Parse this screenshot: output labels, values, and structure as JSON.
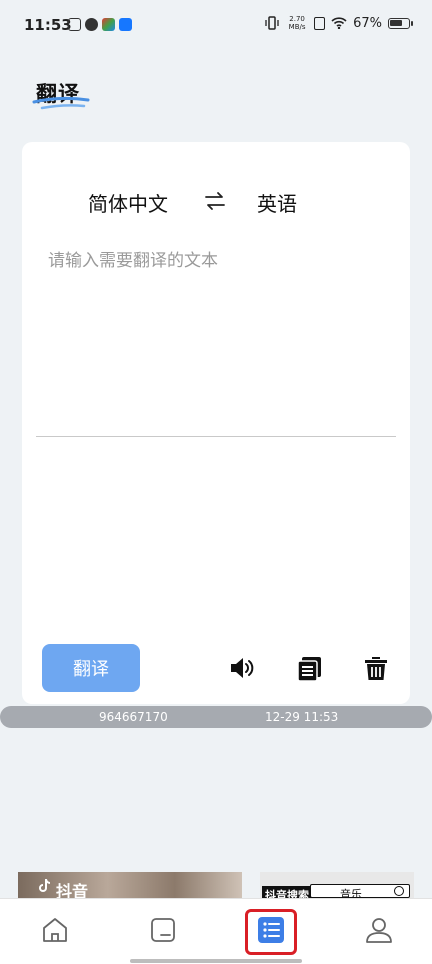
{
  "status_bar": {
    "time": "11:53",
    "net_speed_value": "2.70",
    "net_speed_unit": "MB/s",
    "battery_percent": "67%"
  },
  "header": {
    "title": "翻译"
  },
  "translator": {
    "source_language": "简体中文",
    "swap_symbol": "⇌",
    "target_language": "英语",
    "input_placeholder": "请输入需要翻译的文本",
    "input_value": "",
    "translate_button_label": "翻译"
  },
  "info_bar": {
    "id": "964667170",
    "datetime": "12-29 11:53"
  },
  "ads": {
    "left_label": "抖音",
    "right_tag": "抖音搜索",
    "right_search_text": "音乐"
  },
  "bottom_nav": {
    "items": [
      {
        "icon": "home-icon",
        "active": false
      },
      {
        "icon": "document-icon",
        "active": false
      },
      {
        "icon": "list-icon",
        "active": true
      },
      {
        "icon": "user-icon",
        "active": false
      }
    ],
    "active_color": "#3d7ee6",
    "highlight_color": "#d91f26"
  },
  "colors": {
    "accent": "#6ea7f1",
    "background": "#eef2f5"
  }
}
